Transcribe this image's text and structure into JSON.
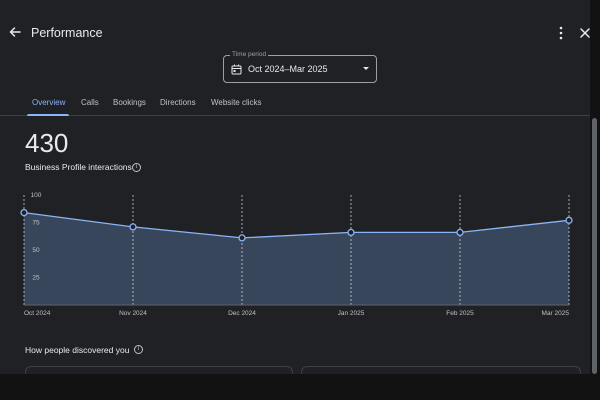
{
  "header": {
    "title": "Performance",
    "back_icon": "arrow-back-icon",
    "more_icon": "more-vert-icon",
    "close_icon": "close-icon"
  },
  "time_period": {
    "label": "Time period",
    "value": "Oct 2024–Mar 2025",
    "icon": "calendar-icon"
  },
  "tabs": [
    {
      "label": "Overview",
      "active": true
    },
    {
      "label": "Calls",
      "active": false
    },
    {
      "label": "Bookings",
      "active": false
    },
    {
      "label": "Directions",
      "active": false
    },
    {
      "label": "Website clicks",
      "active": false
    }
  ],
  "summary": {
    "total": "430",
    "label": "Business Profile interactions"
  },
  "chart_data": {
    "type": "area",
    "categories": [
      "Oct 2024",
      "Nov 2024",
      "Dec 2024",
      "Jan 2025",
      "Feb 2025",
      "Mar 2025"
    ],
    "values": [
      84,
      71,
      61,
      66,
      66,
      77
    ],
    "yticks": [
      25,
      50,
      75,
      100
    ],
    "ylim": [
      0,
      100
    ],
    "grid": false,
    "line_color": "#8ab4f8",
    "fill_color": "#38465c"
  },
  "discovery": {
    "title": "How people discovered you"
  },
  "colors": {
    "background": "#202124",
    "accent": "#8ab4f8",
    "text": "#e8eaed"
  }
}
